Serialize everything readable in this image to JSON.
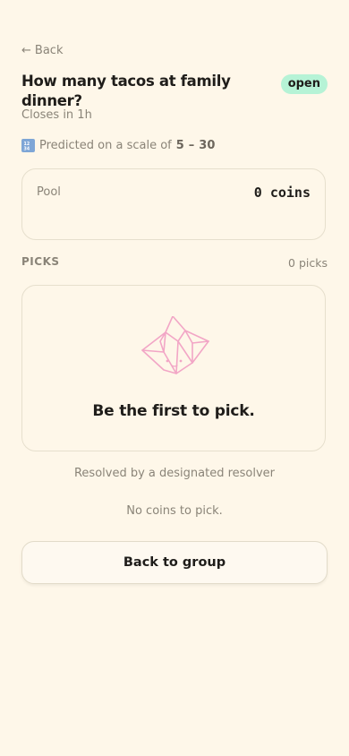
{
  "nav": {
    "back_label": "Back",
    "back_arrow": "←"
  },
  "market": {
    "title": "How many tacos at family dinner?",
    "status": "open",
    "closes": "Closes in 1h",
    "predict_prefix": "Predicted on a scale of",
    "scale_min": "5",
    "scale_sep": "–",
    "scale_max": "30",
    "scale_icon": "1234"
  },
  "pool": {
    "label": "Pool",
    "value": "0 coins"
  },
  "picks": {
    "label": "PICKS",
    "count": "0 picks",
    "empty_text": "Be the first to pick."
  },
  "resolver_note": "Resolved by a designated resolver",
  "coins_note": "No coins to pick.",
  "back_to_group_label": "Back to group",
  "colors": {
    "background": "#fef7e9",
    "badge_open": "#b6f3d6",
    "illustration": "#f2a6c6",
    "muted_text": "#8a8478"
  },
  "icons": {
    "empty_state": "origami-fortune-teller-icon",
    "scale": "numbers-icon"
  }
}
